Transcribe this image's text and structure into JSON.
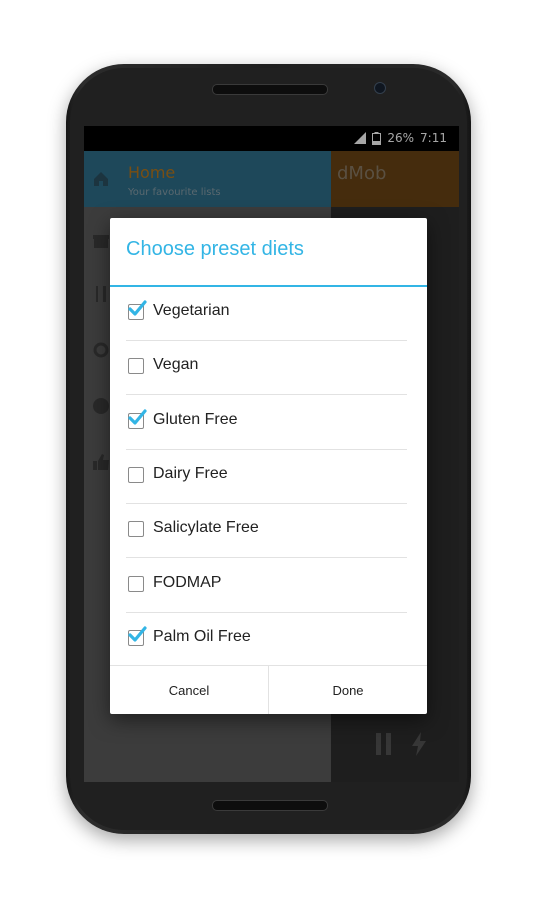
{
  "status_bar": {
    "battery": "26%",
    "time": "7:11"
  },
  "background_app": {
    "drawer_title": "Home",
    "drawer_subtitle": "Your favourite lists",
    "ad_text": "dMob"
  },
  "dialog": {
    "title": "Choose preset diets",
    "items": [
      {
        "label": "Vegetarian",
        "checked": true
      },
      {
        "label": "Vegan",
        "checked": false
      },
      {
        "label": "Gluten Free",
        "checked": true
      },
      {
        "label": "Dairy Free",
        "checked": false
      },
      {
        "label": "Salicylate Free",
        "checked": false
      },
      {
        "label": "FODMAP",
        "checked": false
      },
      {
        "label": "Palm Oil Free",
        "checked": true
      }
    ],
    "cancel_label": "Cancel",
    "done_label": "Done"
  },
  "colors": {
    "accent": "#33b5e5",
    "checkmark": "#33b5e5"
  }
}
